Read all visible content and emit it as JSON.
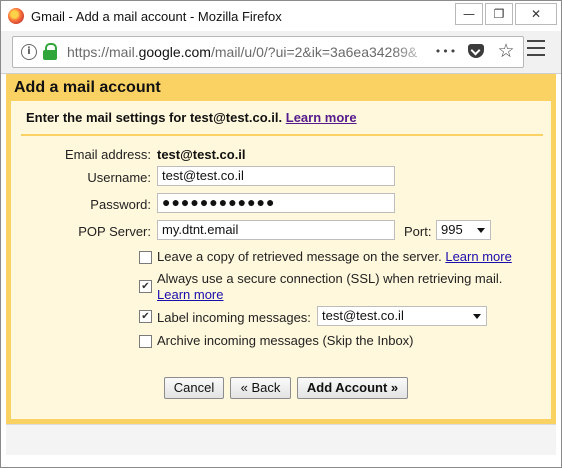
{
  "window": {
    "title": "Gmail - Add a mail account - Mozilla Firefox",
    "controls": {
      "minimize": "—",
      "restore": "❐",
      "close": "✕"
    }
  },
  "browser": {
    "url_prefix": "https://mail.",
    "url_domain": "google.com",
    "url_rest": "/mail/u/0/?ui=2&ik=3a6ea34289&",
    "icons": {
      "more": "•••",
      "bookmark": "☆"
    }
  },
  "dialog": {
    "title": "Add a mail account",
    "intro": "Enter the mail settings for test@test.co.il.",
    "intro_link": "Learn more",
    "email_label": "Email address:",
    "email_value": "test@test.co.il",
    "username_label": "Username:",
    "username_value": "test@test.co.il",
    "password_label": "Password:",
    "password_value": "●●●●●●●●●●●●",
    "pop_label": "POP Server:",
    "pop_value": "my.dtnt.email",
    "port_label": "Port:",
    "port_value": "995",
    "options": {
      "leave_copy": {
        "label": "Leave a copy of retrieved message on the server.",
        "link": "Learn more",
        "checked": false
      },
      "ssl": {
        "label": "Always use a secure connection (SSL) when retrieving mail.",
        "link": "Learn more",
        "checked": true
      },
      "label_incoming": {
        "label": "Label incoming messages:",
        "select_value": "test@test.co.il",
        "checked": true
      },
      "archive": {
        "label": "Archive incoming messages (Skip the Inbox)",
        "checked": false
      }
    },
    "buttons": {
      "cancel": "Cancel",
      "back": "« Back",
      "add": "Add Account »"
    },
    "check_mark": "✔"
  }
}
